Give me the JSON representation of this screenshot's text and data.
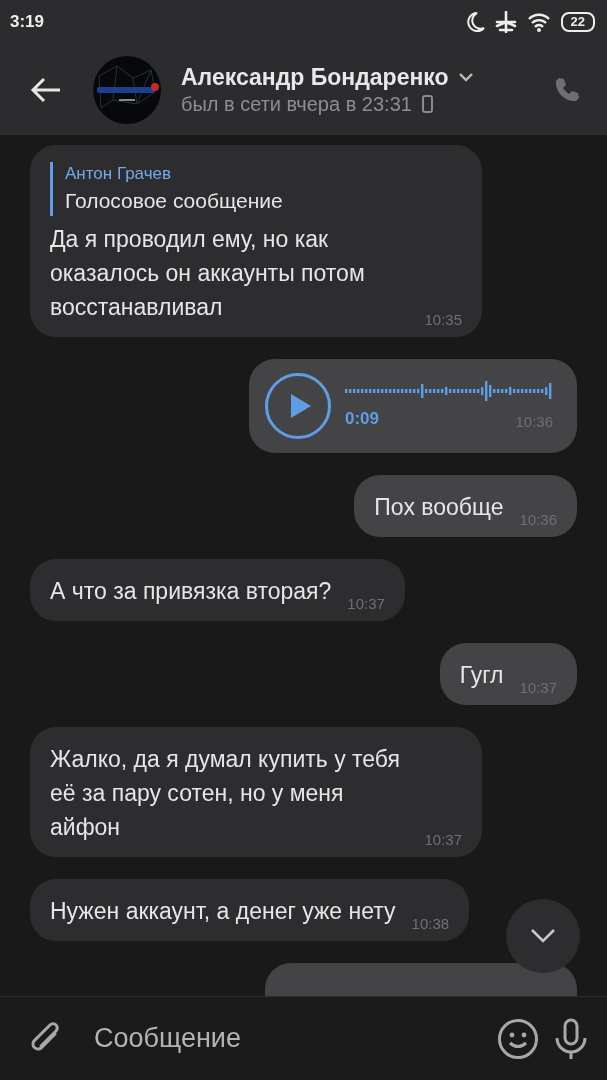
{
  "status_bar": {
    "time": "3:19",
    "battery": "22"
  },
  "header": {
    "name": "Александр Бондаренко",
    "last_seen": "был в сети вчера в 23:31"
  },
  "messages": [
    {
      "kind": "text",
      "outgoing": false,
      "reply": {
        "author": "Антон Грачев",
        "text": "Голосовое сообщение"
      },
      "text": "Да я проводил ему, но как оказалось он аккаунты потом восстанавливал",
      "time": "10:35"
    },
    {
      "kind": "voice",
      "outgoing": true,
      "duration": "0:09",
      "time": "10:36"
    },
    {
      "kind": "text",
      "outgoing": true,
      "text": "Пох вообще",
      "time": "10:36"
    },
    {
      "kind": "text",
      "outgoing": false,
      "text": "А что за привязка вторая?",
      "time": "10:37"
    },
    {
      "kind": "text",
      "outgoing": true,
      "text": "Гугл",
      "time": "10:37"
    },
    {
      "kind": "text",
      "outgoing": false,
      "text": "Жалко, да я думал купить у тебя её за пару сотен, но у меня айфон",
      "time": "10:37"
    },
    {
      "kind": "text",
      "outgoing": false,
      "text": "Нужен аккаунт, а денег уже нету",
      "time": "10:38"
    },
    {
      "kind": "cut",
      "outgoing": true
    }
  ],
  "composer": {
    "placeholder": "Сообщение"
  }
}
